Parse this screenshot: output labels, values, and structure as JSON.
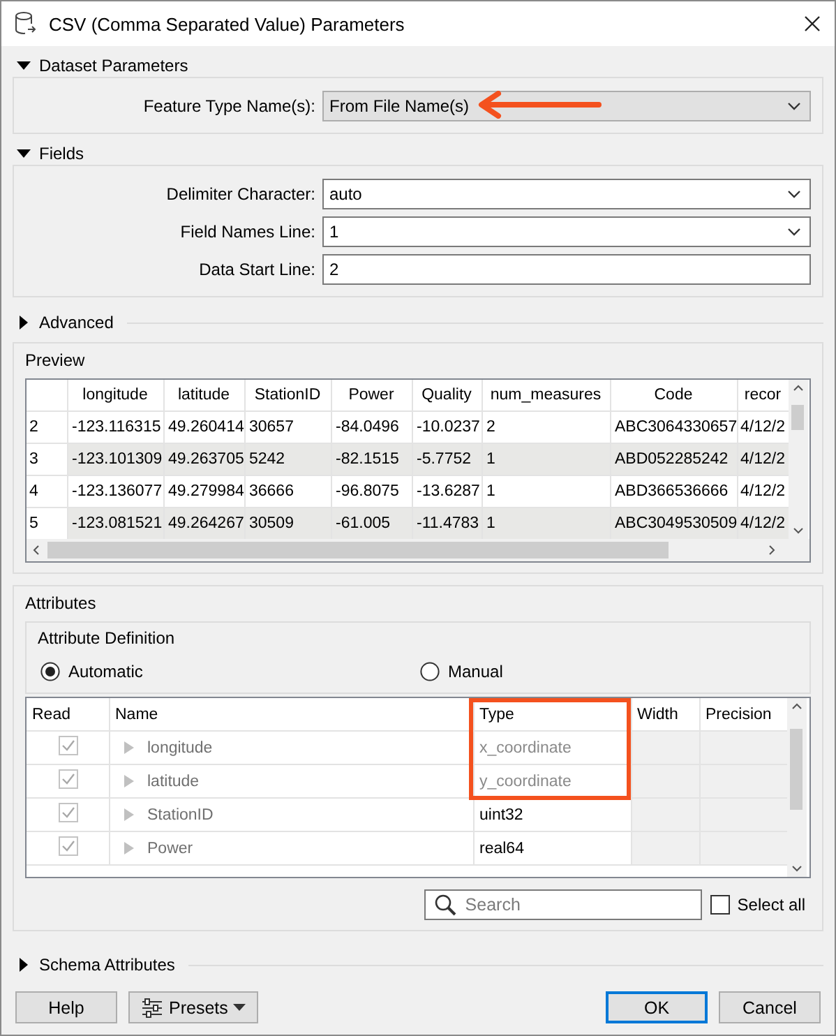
{
  "window": {
    "title": "CSV (Comma Separated Value) Parameters"
  },
  "dataset_parameters": {
    "title": "Dataset Parameters",
    "expanded": true,
    "fields": [
      {
        "label": "Feature Type Name(s):",
        "value": "From File Name(s)",
        "kind": "select",
        "annotated": true
      }
    ]
  },
  "fields": {
    "title": "Fields",
    "expanded": true,
    "fields": [
      {
        "label": "Delimiter Character:",
        "value": "auto",
        "kind": "combo",
        "annotated": false
      },
      {
        "label": "Field Names Line:",
        "value": "1",
        "kind": "combo",
        "annotated": false
      },
      {
        "label": "Data Start Line:",
        "value": "2",
        "kind": "text",
        "annotated": false
      }
    ]
  },
  "advanced": {
    "title": "Advanced",
    "expanded": false
  },
  "preview": {
    "title": "Preview",
    "columns": [
      "longitude",
      "latitude",
      "StationID",
      "Power",
      "Quality",
      "num_measures",
      "Code",
      "recor"
    ],
    "rows": [
      {
        "number": "2",
        "cells": [
          "-123.116315",
          "49.260414",
          "30657",
          "-84.0496",
          "-10.0237",
          "2",
          "ABC3064330657",
          "4/12/2"
        ]
      },
      {
        "number": "3",
        "cells": [
          "-123.101309",
          "49.263705",
          "5242",
          "-82.1515",
          "-5.7752",
          "1",
          "ABD052285242",
          "4/12/2"
        ]
      },
      {
        "number": "4",
        "cells": [
          "-123.136077",
          "49.279984",
          "36666",
          "-96.8075",
          "-13.6287",
          "1",
          "ABD366536666",
          "4/12/2"
        ]
      },
      {
        "number": "5",
        "cells": [
          "-123.081521",
          "49.264267",
          "30509",
          "-61.005",
          "-11.4783",
          "1",
          "ABC3049530509",
          "4/12/2"
        ]
      }
    ]
  },
  "attributes": {
    "title": "Attributes",
    "definition": {
      "title": "Attribute Definition",
      "options": [
        {
          "label": "Automatic",
          "selected": true
        },
        {
          "label": "Manual",
          "selected": false
        }
      ]
    },
    "columns": [
      {
        "label": "Read",
        "highlighted": false
      },
      {
        "label": "Name",
        "highlighted": false
      },
      {
        "label": "Type",
        "highlighted": true
      },
      {
        "label": "Width",
        "highlighted": false
      },
      {
        "label": "Precision",
        "highlighted": false
      }
    ],
    "rows": [
      {
        "read": true,
        "name": "longitude",
        "type": "x_coordinate",
        "disabled": true
      },
      {
        "read": true,
        "name": "latitude",
        "type": "y_coordinate",
        "disabled": true
      },
      {
        "read": true,
        "name": "StationID",
        "type": "uint32",
        "disabled": false
      },
      {
        "read": true,
        "name": "Power",
        "type": "real64",
        "disabled": false
      }
    ],
    "search": {
      "placeholder": "Search"
    },
    "select_all": {
      "label": "Select all",
      "checked": false
    }
  },
  "schema_attributes": {
    "title": "Schema Attributes",
    "expanded": false
  },
  "buttons": [
    {
      "label": "Help",
      "kind": "plain"
    },
    {
      "label": "Presets",
      "kind": "menu"
    },
    {
      "label": "OK",
      "kind": "default"
    },
    {
      "label": "Cancel",
      "kind": "plain"
    }
  ]
}
